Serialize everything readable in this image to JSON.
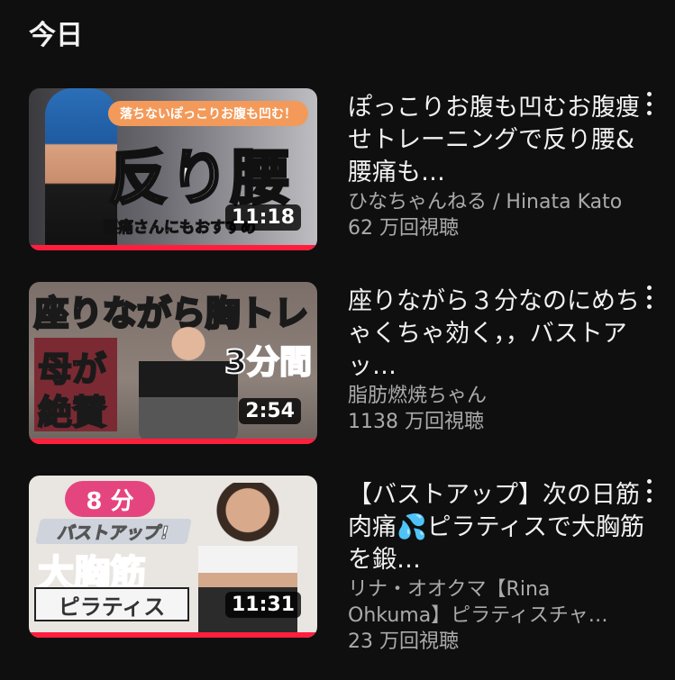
{
  "section": {
    "title": "今日"
  },
  "videos": [
    {
      "title": "ぽっこりお腹も凹むお腹痩せトレーニングで反り腰&腰痛も…",
      "channel": "ひなちゃんねる / Hinata Kato",
      "views": "62 万回視聴",
      "duration": "11:18",
      "thumb": {
        "banner": "落ちないぽっこりお腹も凹む！",
        "big": "反り腰",
        "sub": "腰痛さんにもおすすめ"
      },
      "watched_fraction": 1.0
    },
    {
      "title": "座りながら３分なのにめちゃくちゃ効く，，バストアッ…",
      "channel": "脂肪燃焼ちゃん",
      "views": "1138 万回視聴",
      "duration": "2:54",
      "thumb": {
        "top": "座りながら胸トレ",
        "block1": "母が",
        "block2": "絶賛",
        "time": "3分間"
      },
      "watched_fraction": 1.0
    },
    {
      "title": "【バストアップ】次の日筋肉痛💦ピラティスで大胸筋を鍛…",
      "channel": "リナ・オオクマ【Rina Ohkuma】ピラティスチャ…",
      "views": "23 万回視聴",
      "duration": "11:31",
      "thumb": {
        "pill": "8 分",
        "strip": "バストアップ!",
        "big": "大胸筋",
        "pila": "ピラティス"
      },
      "watched_fraction": 1.0
    }
  ],
  "colors": {
    "background": "#0f0f0f",
    "progress": "#ff1f3d",
    "secondary_text": "#aaaaaa"
  }
}
